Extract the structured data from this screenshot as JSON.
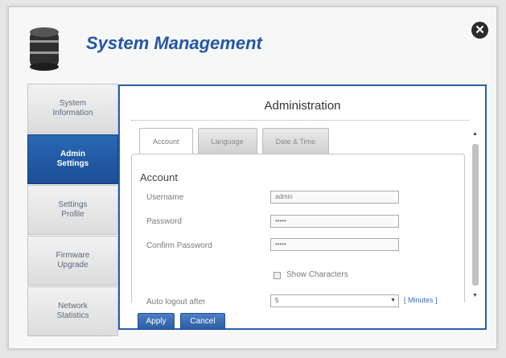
{
  "dialog": {
    "title": "System Management",
    "icons": {
      "app": "database-icon",
      "close": "close-icon"
    },
    "colors": {
      "accent": "#2356a6",
      "active_nav": "#1f5aa5",
      "panel_border": "#2a5ea8"
    }
  },
  "sidebar": {
    "items": [
      {
        "label": "System\nInformation",
        "active": false
      },
      {
        "label": "Admin\nSettings",
        "active": true
      },
      {
        "label": "Settings\nProfile",
        "active": false
      },
      {
        "label": "Firmware\nUpgrade",
        "active": false
      },
      {
        "label": "Network\nStatistics",
        "active": false
      }
    ]
  },
  "panel": {
    "title": "Administration",
    "tabs": [
      {
        "label": "Account",
        "active": true
      },
      {
        "label": "Language",
        "active": false
      },
      {
        "label": "Date & Time",
        "active": false
      }
    ],
    "section_title": "Account",
    "fields": {
      "username": {
        "label": "Username",
        "value": "admin"
      },
      "password": {
        "label": "Password",
        "value": "•••••"
      },
      "confirm_password": {
        "label": "Confirm Password",
        "value": "•••••"
      }
    },
    "show_characters": {
      "label": "Show Characters",
      "checked": false
    },
    "auto_logout": {
      "label": "Auto logout after",
      "value": "5",
      "unit_link": "[ Minutes ]"
    }
  },
  "buttons": {
    "apply": "Apply",
    "cancel": "Cancel"
  }
}
